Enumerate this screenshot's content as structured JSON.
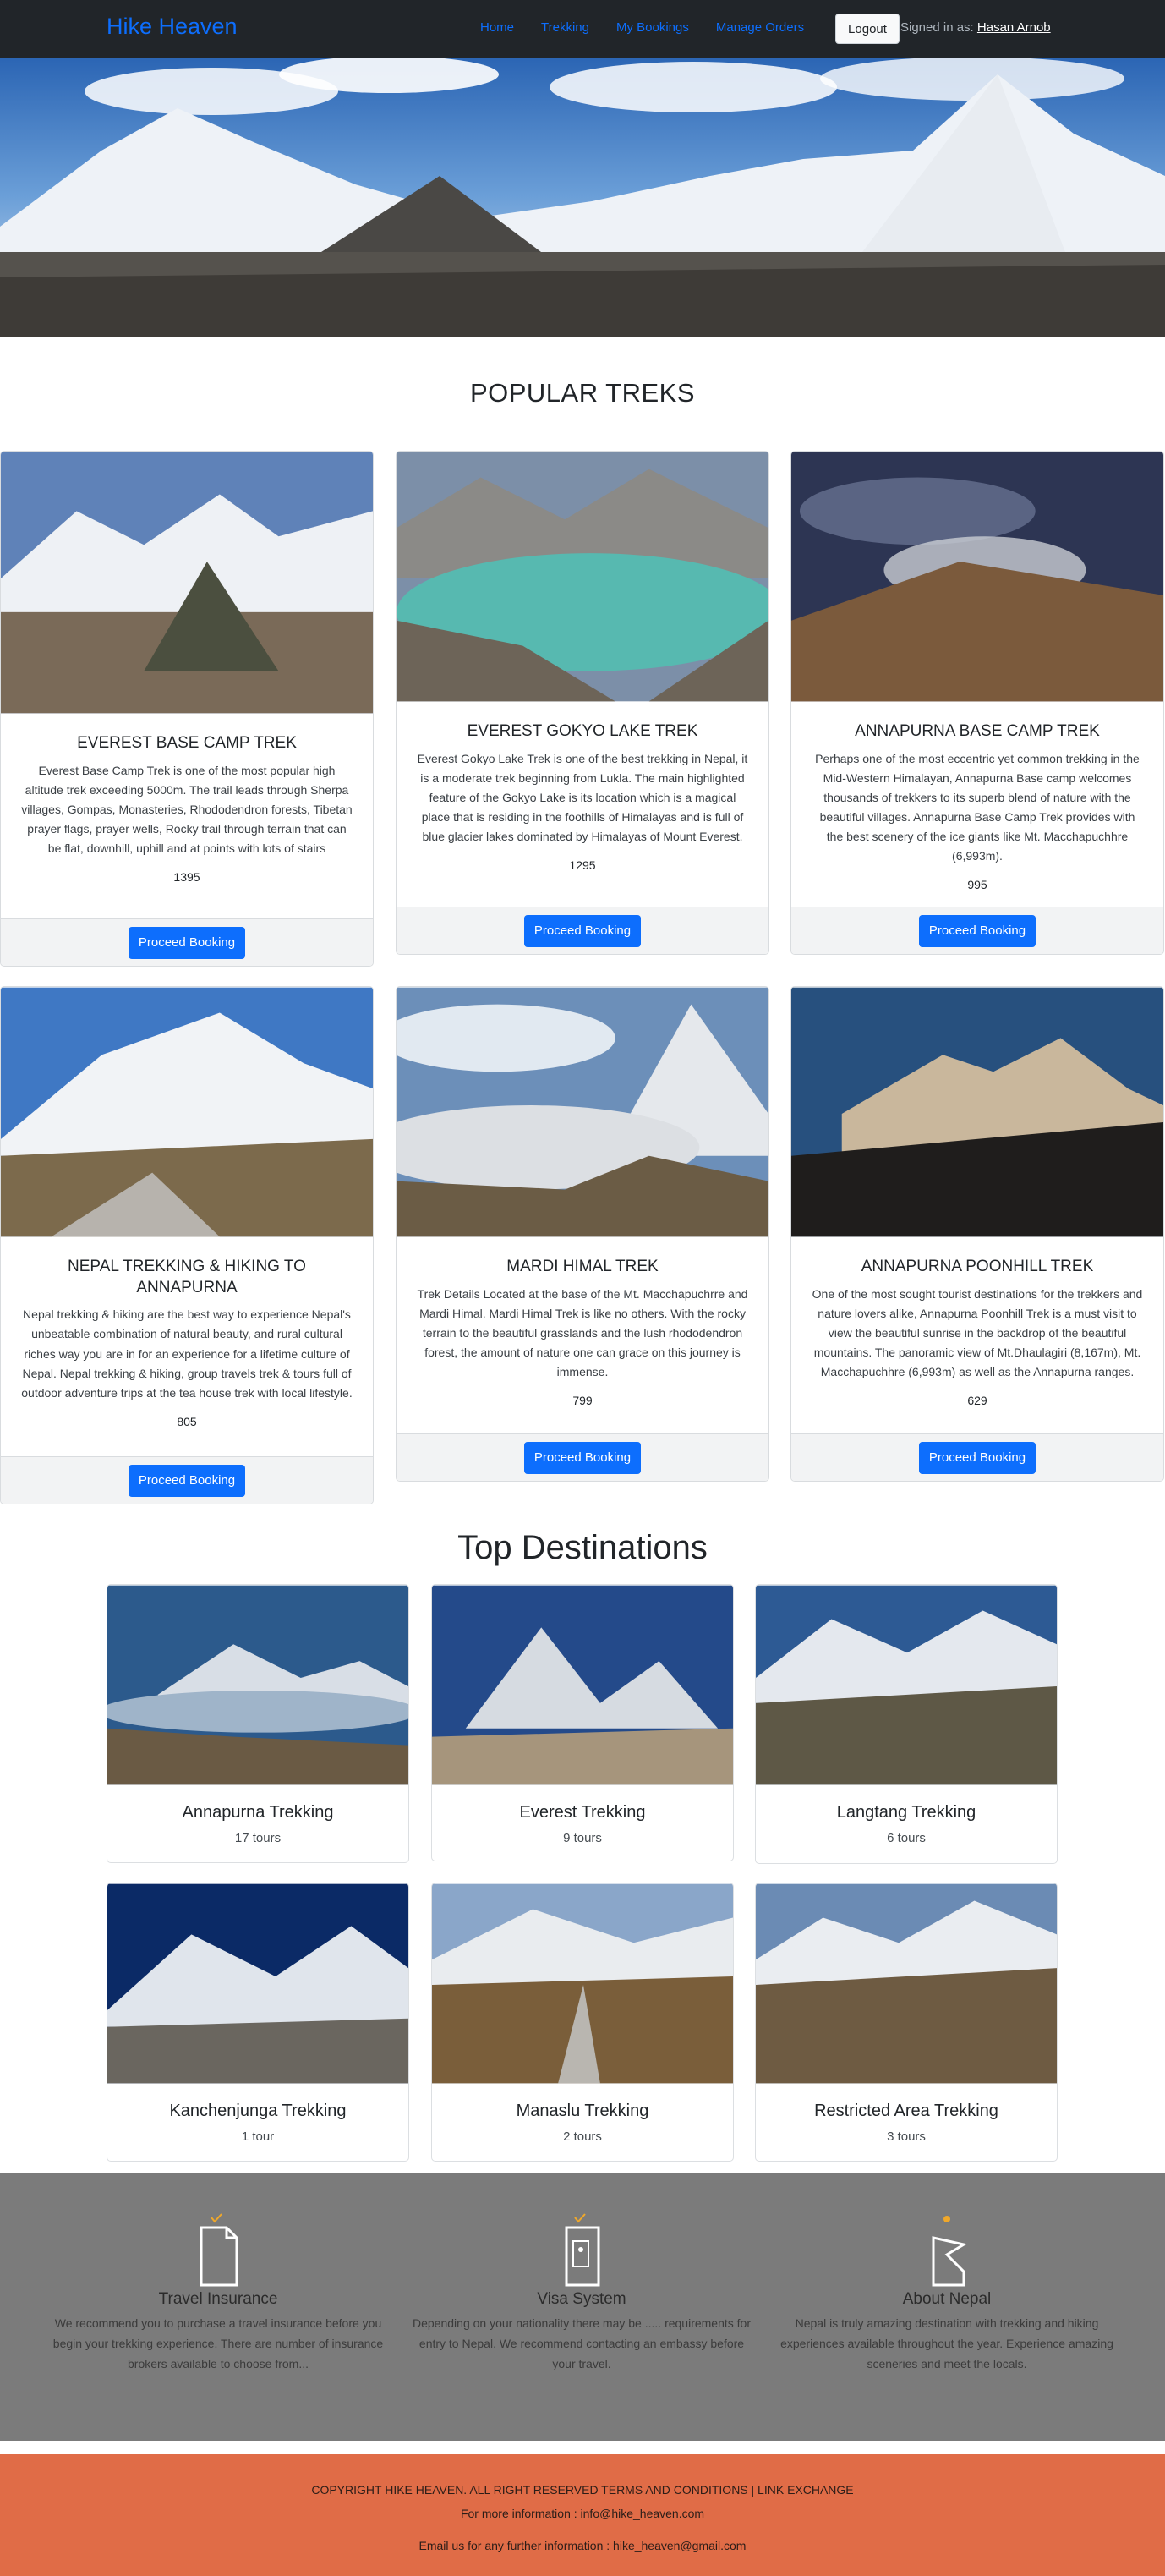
{
  "nav": {
    "brand": "Hike Heaven",
    "links": [
      "Home",
      "Trekking",
      "My Bookings",
      "Manage Orders"
    ],
    "logout_label": "Logout",
    "signed_in_prefix": "Signed in as:",
    "user_name": "Hasan Arnob"
  },
  "popular": {
    "title": "POPULAR TREKS",
    "cards": [
      {
        "title": "EVEREST BASE CAMP TREK",
        "desc": "Everest Base Camp Trek is one of the most popular high altitude trek exceeding 5000m. The trail leads through Sherpa villages, Gompas, Monasteries, Rhododendron forests, Tibetan prayer flags, prayer wells, Rocky trail through terrain that can be flat, downhill, uphill and at points with lots of stairs",
        "price": "1395",
        "button": "Proceed Booking"
      },
      {
        "title": "EVEREST GOKYO LAKE TREK",
        "desc": "Everest Gokyo Lake Trek is one of the best trekking in Nepal, it is a moderate trek beginning from Lukla. The main highlighted feature of the Gokyo Lake is its location which is a magical place that is residing in the foothills of Himalayas and is full of blue glacier lakes dominated by Himalayas of Mount Everest.",
        "price": "1295",
        "button": "Proceed Booking"
      },
      {
        "title": "ANNAPURNA BASE CAMP TREK",
        "desc": "Perhaps one of the most eccentric yet common trekking in the Mid-Western Himalayan, Annapurna Base camp welcomes thousands of trekkers to its superb blend of nature with the beautiful villages. Annapurna Base Camp Trek provides with the best scenery of the ice giants like Mt. Macchapuchhre (6,993m).",
        "price": "995",
        "button": "Proceed Booking"
      },
      {
        "title": "NEPAL TREKKING & HIKING TO ANNAPURNA",
        "desc": "Nepal trekking & hiking are the best way to experience Nepal's unbeatable combination of natural beauty, and rural cultural riches way you are in for an experience for a lifetime culture of Nepal. Nepal trekking & hiking, group travels trek & tours full of outdoor adventure trips at the tea house trek with local lifestyle.",
        "price": "805",
        "button": "Proceed Booking"
      },
      {
        "title": "MARDI HIMAL TREK",
        "desc": "Trek Details Located at the base of the Mt. Macchapuchrre and Mardi Himal. Mardi Himal Trek is like no others. With the rocky terrain to the beautiful grasslands and the lush rhododendron forest, the amount of nature one can grace on this journey is immense.",
        "price": "799",
        "button": "Proceed Booking"
      },
      {
        "title": "ANNAPURNA POONHILL TREK",
        "desc": "One of the most sought tourist destinations for the trekkers and nature lovers alike, Annapurna Poonhill Trek is a must visit to view the beautiful sunrise in the backdrop of the beautiful mountains. The panoramic view of Mt.Dhaulagiri (8,167m), Mt. Macchapuchhre (6,993m) as well as the Annapurna ranges.",
        "price": "629",
        "button": "Proceed Booking"
      }
    ]
  },
  "destinations": {
    "title": "Top Destinations",
    "items": [
      {
        "name": "Annapurna Trekking",
        "tours": "17 tours"
      },
      {
        "name": "Everest Trekking",
        "tours": "9 tours"
      },
      {
        "name": "Langtang Trekking",
        "tours": "6 tours"
      },
      {
        "name": "Kanchenjunga Trekking",
        "tours": "1 tour"
      },
      {
        "name": "Manaslu Trekking",
        "tours": "2 tours"
      },
      {
        "name": "Restricted Area Trekking",
        "tours": "3 tours"
      }
    ]
  },
  "info": [
    {
      "title": "Travel Insurance",
      "text": "We recommend you to purchase a travel insurance before you begin your trekking experience. There are number of insurance brokers available to choose from...",
      "icon": "document-icon"
    },
    {
      "title": "Visa System",
      "text": "Depending on your nationality there may be ..... requirements for entry to Nepal. We recommend contacting an embassy before your travel.",
      "icon": "passport-icon"
    },
    {
      "title": "About Nepal",
      "text": "Nepal is truly amazing destination with trekking and hiking experiences available throughout the year. Experience amazing sceneries and meet the locals.",
      "icon": "map-pin-icon"
    }
  ],
  "footer": {
    "copyright": "COPYRIGHT HIKE HEAVEN. ALL RIGHT RESERVED TERMS AND CONDITIONS | LINK EXCHANGE",
    "info": "For more information : info@hike_heaven.com",
    "email": "Email us for any further information : hike_heaven@gmail.com"
  },
  "colors": {
    "brand": "#0d6efd",
    "navbar": "#212529",
    "info_band": "#7b7b7b",
    "footer": "#e06c47",
    "icon_accent": "#f0a82a"
  }
}
